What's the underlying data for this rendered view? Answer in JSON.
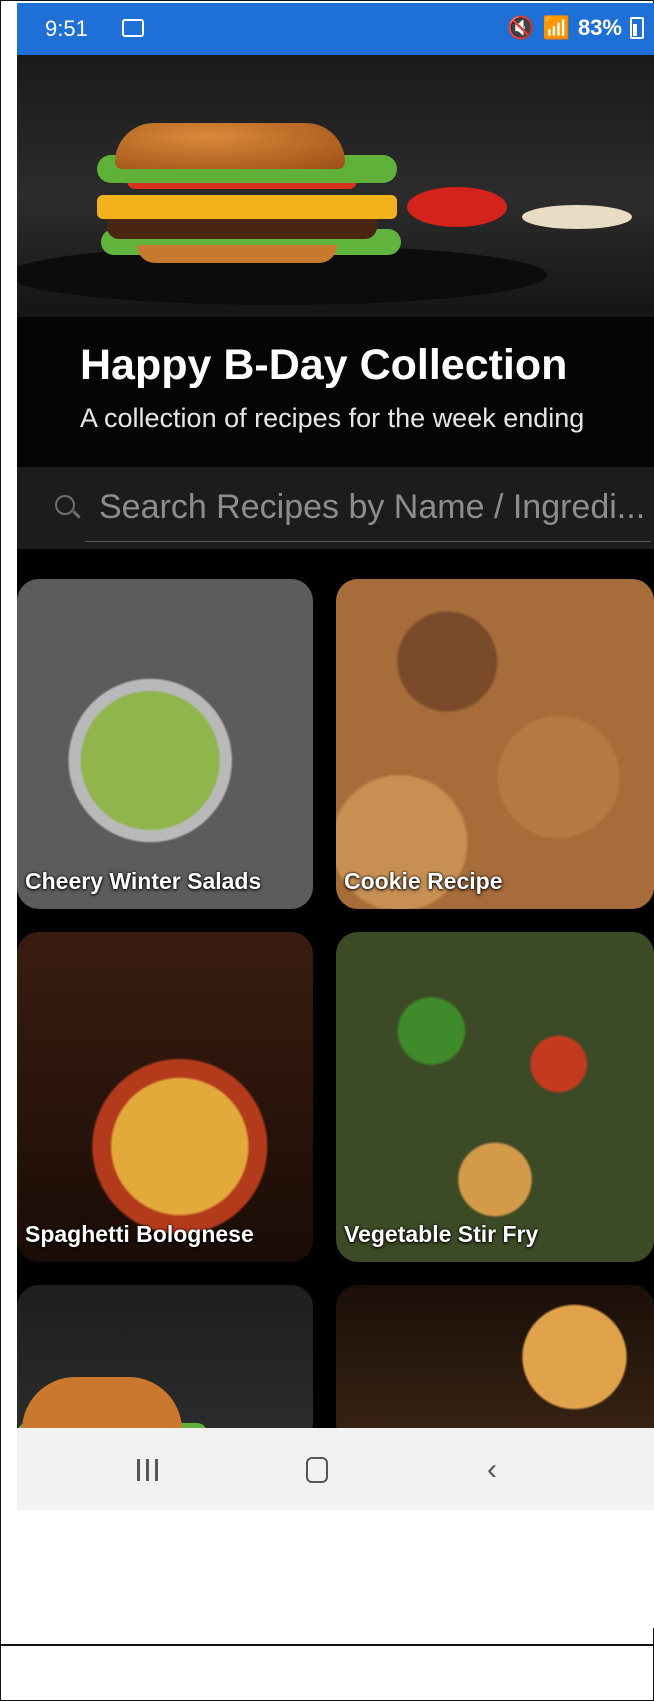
{
  "status_bar": {
    "time": "9:51",
    "battery": "83%"
  },
  "collection": {
    "title": "Happy B-Day Collection",
    "subtitle": "A collection of recipes for the week ending"
  },
  "search": {
    "placeholder": "Search Recipes by Name / Ingredi..."
  },
  "recipes": [
    {
      "label": "Cheery Winter Salads"
    },
    {
      "label": "Cookie Recipe"
    },
    {
      "label": "Spaghetti Bolognese"
    },
    {
      "label": "Vegetable Stir Fry"
    }
  ],
  "nav": {
    "back_glyph": "‹"
  },
  "colors": {
    "status_bar": "#1e6fd6",
    "background": "#000000",
    "search_bg": "#1c1c1c"
  }
}
